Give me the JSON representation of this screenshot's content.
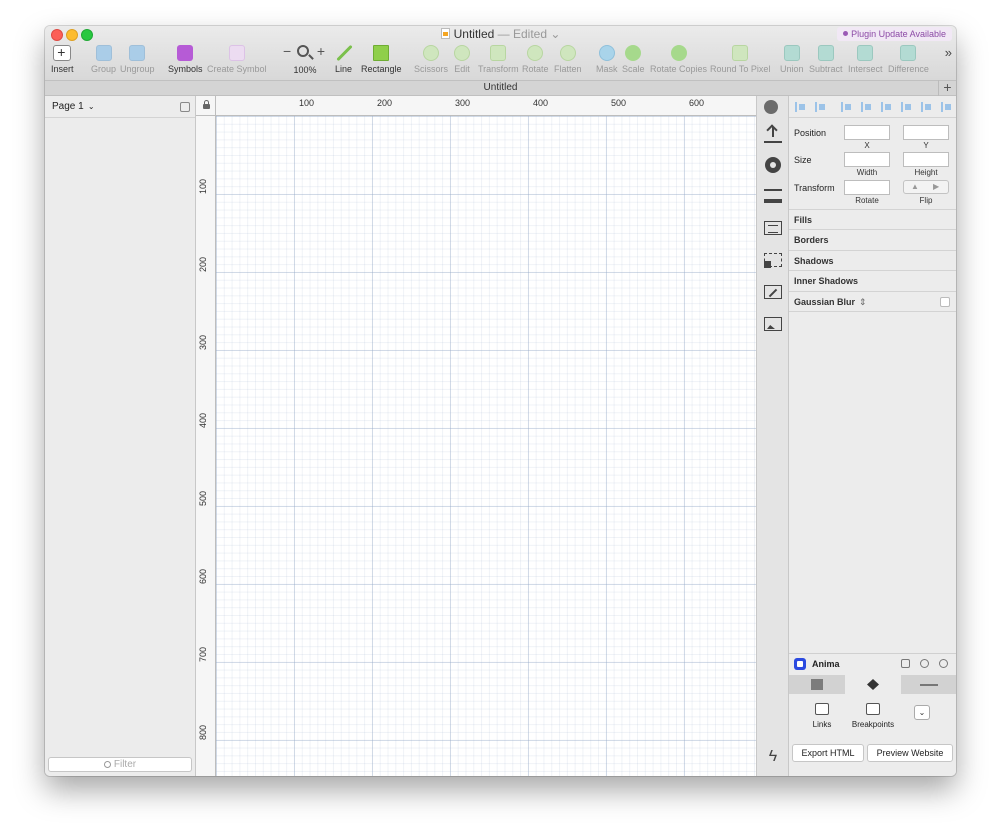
{
  "window": {
    "doc_title": "Untitled",
    "doc_status": "— Edited",
    "plugin_update": "Plugin Update Available"
  },
  "toolbar": {
    "tools": [
      {
        "label": "Insert",
        "icon": "insert-icon",
        "enabled": true
      },
      {
        "label": "Group",
        "icon": "group-icon",
        "enabled": false
      },
      {
        "label": "Ungroup",
        "icon": "ungroup-icon",
        "enabled": false
      },
      {
        "label": "Symbols",
        "icon": "symbols-icon",
        "enabled": true
      },
      {
        "label": "Create Symbol",
        "icon": "create-symbol-icon",
        "enabled": false
      },
      {
        "label": "Line",
        "icon": "line-icon",
        "enabled": true
      },
      {
        "label": "Rectangle",
        "icon": "rectangle-icon",
        "enabled": true
      },
      {
        "label": "Scissors",
        "icon": "scissors-icon",
        "enabled": false
      },
      {
        "label": "Edit",
        "icon": "edit-icon",
        "enabled": false
      },
      {
        "label": "Transform",
        "icon": "transform-icon",
        "enabled": false
      },
      {
        "label": "Rotate",
        "icon": "rotate-icon",
        "enabled": false
      },
      {
        "label": "Flatten",
        "icon": "flatten-icon",
        "enabled": false
      },
      {
        "label": "Mask",
        "icon": "mask-icon",
        "enabled": false
      },
      {
        "label": "Scale",
        "icon": "scale-icon",
        "enabled": false
      },
      {
        "label": "Rotate Copies",
        "icon": "rotate-copies-icon",
        "enabled": false
      },
      {
        "label": "Round To Pixel",
        "icon": "round-to-pixel-icon",
        "enabled": false
      },
      {
        "label": "Union",
        "icon": "union-icon",
        "enabled": false
      },
      {
        "label": "Subtract",
        "icon": "subtract-icon",
        "enabled": false
      },
      {
        "label": "Intersect",
        "icon": "intersect-icon",
        "enabled": false
      },
      {
        "label": "Difference",
        "icon": "difference-icon",
        "enabled": false
      }
    ],
    "zoom": {
      "minus": "−",
      "plus": "+",
      "value": "100%"
    },
    "overflow": "»"
  },
  "tabbar": {
    "title": "Untitled",
    "add": "+"
  },
  "left_panel": {
    "page_name": "Page 1",
    "filter_placeholder": "Filter"
  },
  "canvas": {
    "ruler_top_labels": [
      "100",
      "200",
      "300",
      "400",
      "500",
      "600"
    ],
    "ruler_left_labels": [
      "100",
      "200",
      "300",
      "400",
      "500",
      "600",
      "700",
      "800"
    ]
  },
  "inspector": {
    "position_label": "Position",
    "x_label": "X",
    "y_label": "Y",
    "size_label": "Size",
    "width_label": "Width",
    "height_label": "Height",
    "transform_label": "Transform",
    "rotate_label": "Rotate",
    "flip_label": "Flip",
    "sections": {
      "fills": "Fills",
      "borders": "Borders",
      "shadows": "Shadows",
      "inner_shadows": "Inner Shadows",
      "gaussian_blur": "Gaussian Blur"
    }
  },
  "anima": {
    "title": "Anima",
    "links": "Links",
    "breakpoints": "Breakpoints",
    "export_html": "Export HTML",
    "preview_website": "Preview Website"
  },
  "colors": {
    "accent_purple": "#b65bd6",
    "rectangle_green": "#8fcf4a",
    "anima_blue": "#2b4ae0",
    "align_blue": "#9cc3e8"
  }
}
